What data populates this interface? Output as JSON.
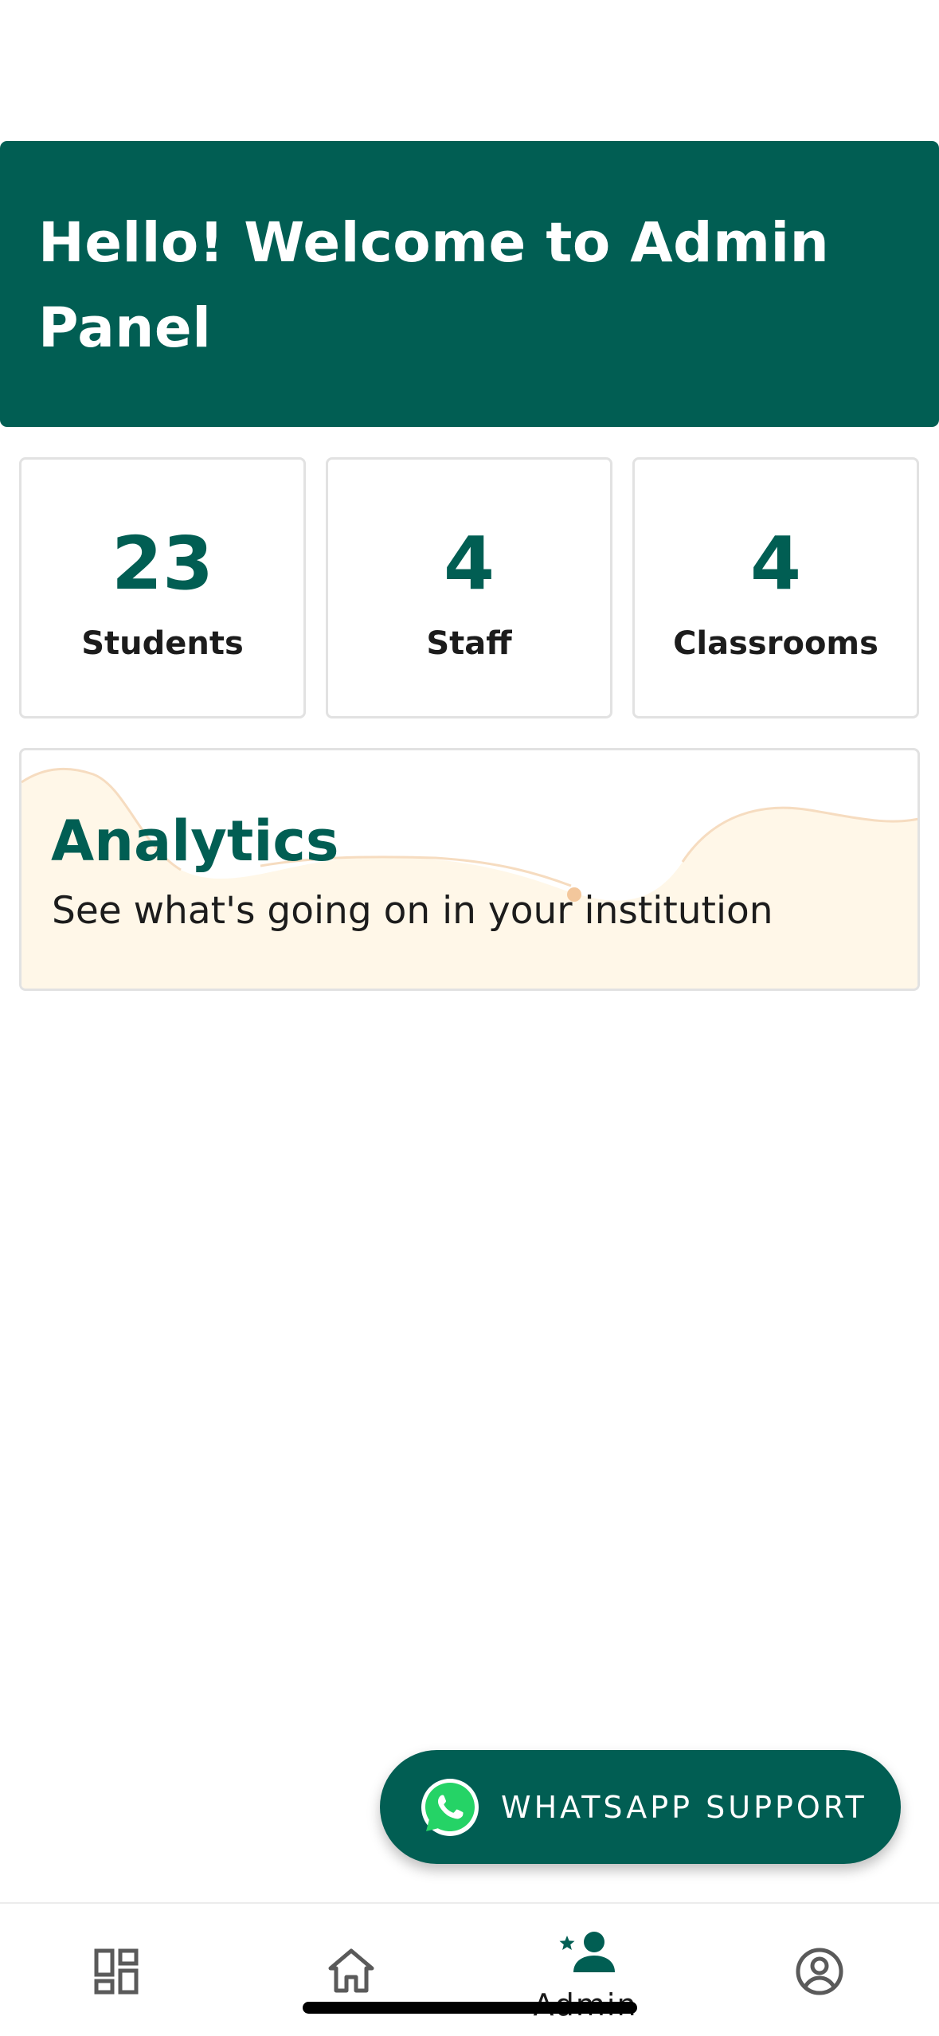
{
  "header": {
    "title": "Hello! Welcome to Admin Panel"
  },
  "stats": [
    {
      "value": "23",
      "label": "Students"
    },
    {
      "value": "4",
      "label": "Staff"
    },
    {
      "value": "4",
      "label": "Classrooms"
    }
  ],
  "analytics": {
    "title": "Analytics",
    "subtitle": "See what's going on in your institution"
  },
  "support": {
    "label": "WHATSAPP SUPPORT",
    "icon": "whatsapp-icon"
  },
  "bottom_nav": {
    "items": [
      {
        "icon": "dashboard-icon",
        "label": ""
      },
      {
        "icon": "home-icon",
        "label": ""
      },
      {
        "icon": "admin-icon",
        "label": "Admin",
        "active": true
      },
      {
        "icon": "account-icon",
        "label": ""
      }
    ]
  },
  "colors": {
    "primary": "#015e53",
    "card_border": "#e2e2e2",
    "analytics_bg": "#fff7e8",
    "whatsapp_green": "#25d366"
  }
}
